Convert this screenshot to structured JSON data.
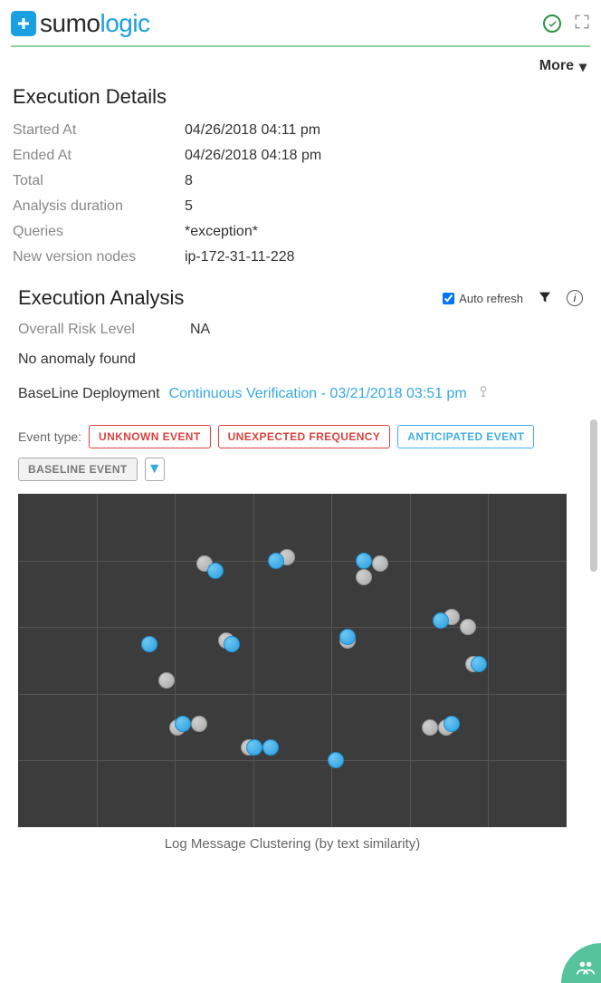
{
  "brand": {
    "name_part1": "sumo",
    "name_part2": "logic"
  },
  "more_label": "More",
  "exec_details": {
    "title": "Execution Details",
    "rows": [
      {
        "label": "Started At",
        "value": "04/26/2018 04:11 pm"
      },
      {
        "label": "Ended At",
        "value": "04/26/2018 04:18 pm"
      },
      {
        "label": "Total",
        "value": "8"
      },
      {
        "label": "Analysis duration",
        "value": "5"
      },
      {
        "label": "Queries",
        "value": "*exception*"
      },
      {
        "label": "New version nodes",
        "value": "ip-172-31-11-228"
      }
    ]
  },
  "analysis": {
    "title": "Execution Analysis",
    "auto_refresh_label": "Auto refresh",
    "auto_refresh_checked": true,
    "risk_label": "Overall Risk Level",
    "risk_value": "NA",
    "anomaly_text": "No anomaly found",
    "baseline_label": "BaseLine Deployment",
    "baseline_link": "Continuous Verification - 03/21/2018 03:51 pm"
  },
  "event_type": {
    "label": "Event type:",
    "chips": {
      "unknown": "UNKNOWN EVENT",
      "unexpected": "UNEXPECTED FREQUENCY",
      "anticipated": "ANTICIPATED EVENT",
      "baseline": "BASELINE EVENT"
    }
  },
  "chart_data": {
    "type": "scatter",
    "title": "Log Message Clustering (by text similarity)",
    "xlabel": "",
    "ylabel": "",
    "xlim": [
      0,
      100
    ],
    "ylim": [
      0,
      100
    ],
    "grid": true,
    "series": [
      {
        "name": "baseline",
        "color": "#a8a8a8",
        "points": [
          {
            "x": 34,
            "y": 79
          },
          {
            "x": 49,
            "y": 81
          },
          {
            "x": 66,
            "y": 79
          },
          {
            "x": 63,
            "y": 75
          },
          {
            "x": 79,
            "y": 63
          },
          {
            "x": 82,
            "y": 60
          },
          {
            "x": 38,
            "y": 56
          },
          {
            "x": 60,
            "y": 56
          },
          {
            "x": 24,
            "y": 55
          },
          {
            "x": 83,
            "y": 49
          },
          {
            "x": 27,
            "y": 44
          },
          {
            "x": 29,
            "y": 30
          },
          {
            "x": 33,
            "y": 31
          },
          {
            "x": 42,
            "y": 24
          },
          {
            "x": 78,
            "y": 30
          },
          {
            "x": 75,
            "y": 30
          }
        ]
      },
      {
        "name": "anticipated",
        "color": "#2a9fe0",
        "points": [
          {
            "x": 36,
            "y": 77
          },
          {
            "x": 47,
            "y": 80
          },
          {
            "x": 63,
            "y": 80
          },
          {
            "x": 77,
            "y": 62
          },
          {
            "x": 60,
            "y": 57
          },
          {
            "x": 39,
            "y": 55
          },
          {
            "x": 24,
            "y": 55
          },
          {
            "x": 84,
            "y": 49
          },
          {
            "x": 30,
            "y": 31
          },
          {
            "x": 43,
            "y": 24
          },
          {
            "x": 46,
            "y": 24
          },
          {
            "x": 58,
            "y": 20
          },
          {
            "x": 79,
            "y": 31
          }
        ]
      }
    ]
  }
}
